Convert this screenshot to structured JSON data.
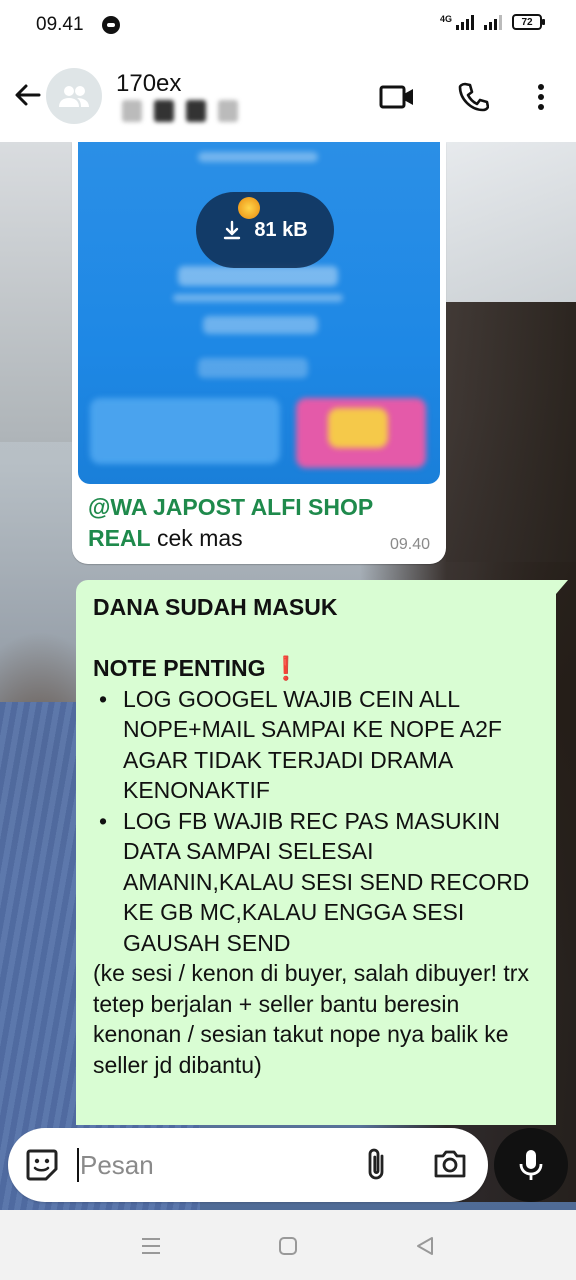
{
  "status_bar": {
    "time": "09.41",
    "network": "4G",
    "battery": "72"
  },
  "header": {
    "title": "170ex",
    "icons": [
      "back-arrow-icon",
      "group-avatar-icon",
      "video-call-icon",
      "phone-icon",
      "more-vert-icon"
    ]
  },
  "messages": {
    "incoming": {
      "download_size": "81 kB",
      "mention": "@WA JAPOST ALFI SHOP REAL",
      "text": " cek mas",
      "time": "09.40"
    },
    "outgoing": {
      "line1": "DANA SUDAH MASUK",
      "note_heading": "NOTE PENTING",
      "note_emoji": "❗",
      "bullets": [
        "LOG GOOGEL WAJIB CEIN ALL NOPE+MAIL SAMPAI KE NOPE A2F AGAR TIDAK TERJADI DRAMA KENONAKTIF",
        "LOG FB WAJIB REC PAS MASUKIN DATA SAMPAI SELESAI AMANIN,KALAU SESI SEND RECORD KE GB MC,KALAU ENGGA SESI GAUSAH SEND"
      ],
      "footer": "(ke sesi / kenon di buyer, salah dibuyer! trx tetep berjalan + seller bantu beresin kenonan / sesian takut nope nya balik ke seller jd dibantu)"
    }
  },
  "composer": {
    "placeholder": "Pesan"
  },
  "colors": {
    "outgoing_bubble": "#d9fdd3",
    "mention": "#1f8a4c",
    "image_blue": "#1e88e5"
  }
}
